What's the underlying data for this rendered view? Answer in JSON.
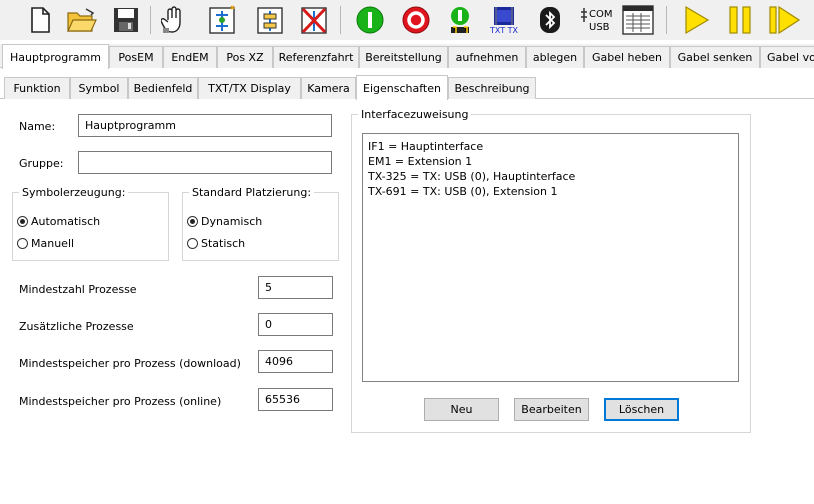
{
  "toolbar": {
    "buttons": [
      {
        "name": "new-file-icon",
        "tip": ""
      },
      {
        "name": "open-folder-icon",
        "tip": ""
      },
      {
        "name": "save-icon",
        "tip": ""
      },
      {
        "name": "hand-tool-icon",
        "tip": ""
      },
      {
        "name": "flowchart-add-icon",
        "tip": ""
      },
      {
        "name": "flowchart-icon",
        "tip": ""
      },
      {
        "name": "flowchart-delete-icon",
        "tip": ""
      },
      {
        "name": "start-green-icon",
        "tip": ""
      },
      {
        "name": "stop-red-icon",
        "tip": ""
      },
      {
        "name": "run-step-icon",
        "tip": ""
      },
      {
        "name": "txt-tx-icon",
        "tip": ""
      },
      {
        "name": "bluetooth-icon",
        "tip": ""
      },
      {
        "name": "com-usb-icon",
        "tip": ""
      },
      {
        "name": "window-table-icon",
        "tip": ""
      },
      {
        "name": "play-icon",
        "tip": ""
      },
      {
        "name": "pause-icon",
        "tip": ""
      },
      {
        "name": "step-forward-icon",
        "tip": ""
      }
    ],
    "txttx_label": "TXT TX",
    "com_label": "COM",
    "usb_label": "USB"
  },
  "program_tabs": [
    "Hauptprogramm",
    "PosEM",
    "EndEM",
    "Pos XZ",
    "Referenzfahrt",
    "Bereitstellung",
    "aufnehmen",
    "ablegen",
    "Gabel heben",
    "Gabel senken",
    "Gabel vo"
  ],
  "sub_tabs": [
    "Funktion",
    "Symbol",
    "Bedienfeld",
    "TXT/TX Display",
    "Kamera",
    "Eigenschaften",
    "Beschreibung"
  ],
  "form": {
    "name_label": "Name:",
    "name_value": "Hauptprogramm",
    "gruppe_label": "Gruppe:",
    "gruppe_value": "",
    "symbol_group": {
      "legend": "Symbolerzeugung:",
      "opt1": "Automatisch",
      "opt2": "Manuell",
      "selected": "Automatisch"
    },
    "platz_group": {
      "legend": "Standard Platzierung:",
      "opt1": "Dynamisch",
      "opt2": "Statisch",
      "selected": "Dynamisch"
    },
    "min_proc_label": "Mindestzahl Prozesse",
    "min_proc_value": "5",
    "extra_proc_label": "Zusätzliche Prozesse",
    "extra_proc_value": "0",
    "mem_dl_label": "Mindestspeicher pro Prozess (download)",
    "mem_dl_value": "4096",
    "mem_on_label": "Mindestspeicher pro Prozess (online)",
    "mem_on_value": "65536"
  },
  "interface": {
    "legend": "Interfacezuweisung",
    "items": [
      "IF1 = Hauptinterface",
      "EM1 = Extension 1",
      "TX-325 = TX: USB (0), Hauptinterface",
      "TX-691 = TX: USB (0), Extension 1"
    ],
    "neu_label": "Neu",
    "bearbeiten_label": "Bearbeiten",
    "loeschen_label": "Löschen"
  },
  "colors": {
    "accent": "#0078d7",
    "green": "#19b219",
    "red": "#e0141e",
    "yellow": "#ffe000"
  }
}
